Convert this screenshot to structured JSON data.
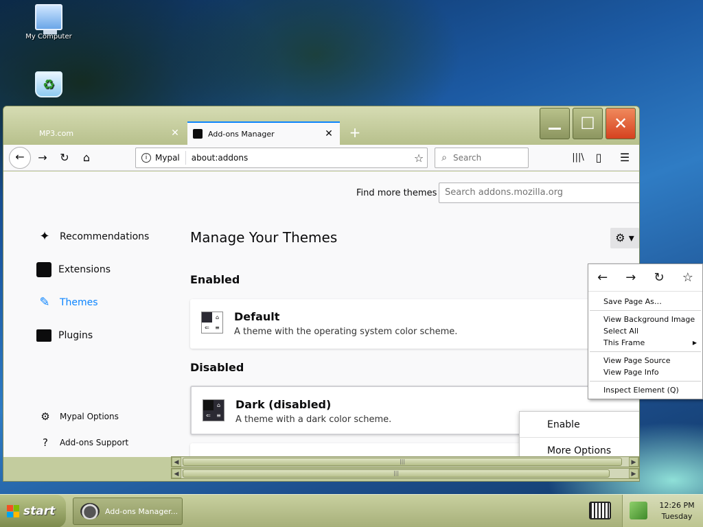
{
  "desktop": {
    "icons": [
      {
        "label": "My Computer"
      },
      {
        "label": ""
      }
    ]
  },
  "window": {
    "tabs": [
      {
        "label": "MP3.com",
        "close": "✕"
      },
      {
        "label": "Add-ons Manager",
        "close": "✕"
      }
    ],
    "newtab": "+",
    "controls": {
      "minimize": "",
      "maximize": "☐",
      "close": "✕"
    }
  },
  "navbar": {
    "back": "←",
    "forward": "→",
    "reload": "↻",
    "home": "⌂",
    "identity": "Mypal",
    "url": "about:addons",
    "bookmark_star": "☆",
    "search_placeholder": "Search",
    "library": "|||\\",
    "sidebar": "▯",
    "menu": "☰"
  },
  "addons": {
    "find_label": "Find more themes",
    "find_placeholder": "Search addons.mozilla.org",
    "categories": [
      {
        "label": "Recommendations",
        "icon": "sparkle-icon"
      },
      {
        "label": "Extensions",
        "icon": "puzzle-icon"
      },
      {
        "label": "Themes",
        "icon": "brush-icon",
        "selected": true
      },
      {
        "label": "Plugins",
        "icon": "plugin-icon"
      }
    ],
    "footer_links": [
      {
        "label": "Mypal Options",
        "icon": "gear-icon"
      },
      {
        "label": "Add-ons Support",
        "icon": "help-icon"
      }
    ],
    "heading": "Manage Your Themes",
    "gear": "⚙ ▾",
    "sections": [
      {
        "title": "Enabled",
        "items": [
          {
            "name": "Default",
            "desc": "A theme with the operating system color scheme."
          }
        ]
      },
      {
        "title": "Disabled",
        "items": [
          {
            "name": "Dark (disabled)",
            "desc": "A theme with a dark color scheme."
          }
        ]
      }
    ],
    "item_menu": [
      "Enable",
      "More Options"
    ]
  },
  "context_menu": {
    "nav": {
      "back": "←",
      "forward": "→",
      "reload": "↻",
      "bookmark": "☆"
    },
    "items": [
      "Save Page As…",
      "View Background Image",
      "Select All",
      "This Frame",
      "View Page Source",
      "View Page Info",
      "Inspect Element (Q)"
    ]
  },
  "taskbar": {
    "start": "start",
    "task": "Add-ons Manager...",
    "clock_time": "12:26 PM",
    "clock_day": "Tuesday"
  },
  "colors": {
    "accent": "#0a84ff",
    "titlebar": "#c3cc9e",
    "close_button": "#d5421f"
  }
}
